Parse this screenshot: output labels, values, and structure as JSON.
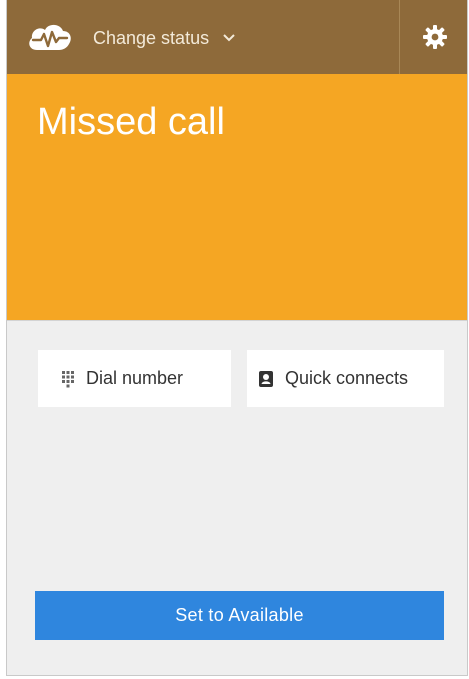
{
  "header": {
    "logo_icon": "cloud-pulse-icon",
    "status_label": "Change status",
    "dropdown_icon": "chevron-down-icon",
    "settings_icon": "gear-icon"
  },
  "banner": {
    "title": "Missed call",
    "color": "#f5a623"
  },
  "actions": [
    {
      "label": "Dial number",
      "icon": "dialpad-icon"
    },
    {
      "label": "Quick connects",
      "icon": "contact-book-icon"
    }
  ],
  "primary_action": {
    "label": "Set to Available",
    "color": "#2f86de"
  },
  "colors": {
    "header": "#8e6a3a",
    "background": "#efefef"
  }
}
